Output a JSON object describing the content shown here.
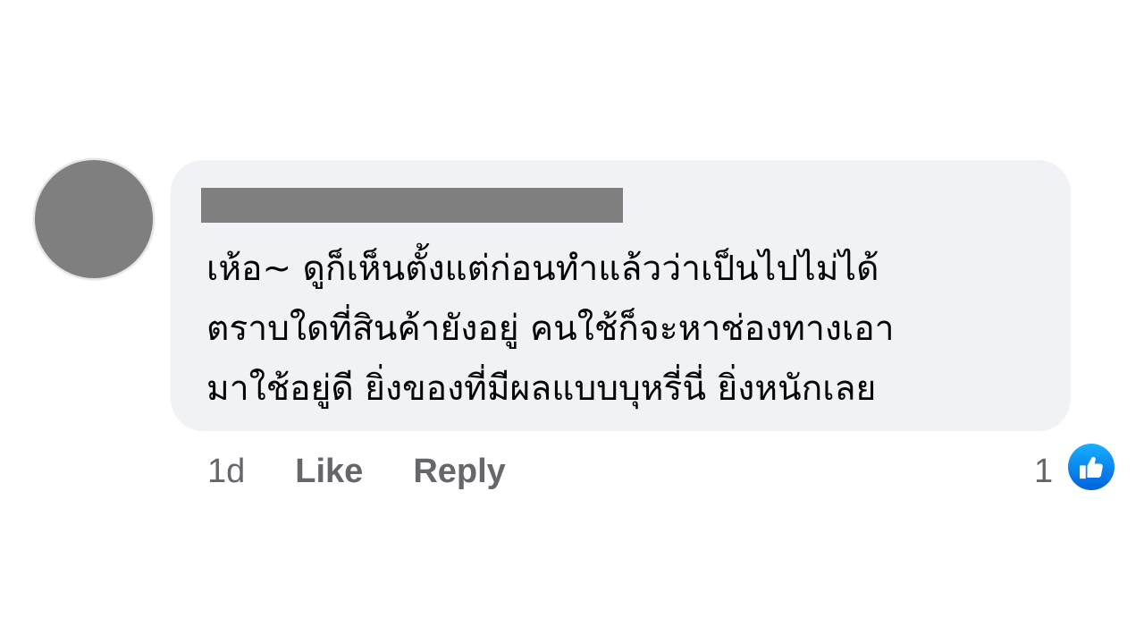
{
  "comment": {
    "text_lines": [
      "เห้อ~ ดูก็เห็นตั้งแต่ก่อนทำแล้วว่าเป็นไปไม่ได้",
      "ตราบใดที่สินค้ายังอยู่ คนใช้ก็จะหาช่องทางเอา",
      "มาใช้อยู่ดี ยิ่งของที่มีผลแบบบุหรี่นี่ ยิ่งหนักเลย"
    ]
  },
  "actions": {
    "time": "1d",
    "like_label": "Like",
    "reply_label": "Reply"
  },
  "reactions": {
    "count": "1",
    "icon": "like-thumbs-up-icon"
  },
  "colors": {
    "bubble_background": "#f0f2f5",
    "redaction": "#7f7f7f",
    "text": "#050505",
    "secondary_text": "#65676b",
    "reaction_blue": "#1877f2"
  }
}
